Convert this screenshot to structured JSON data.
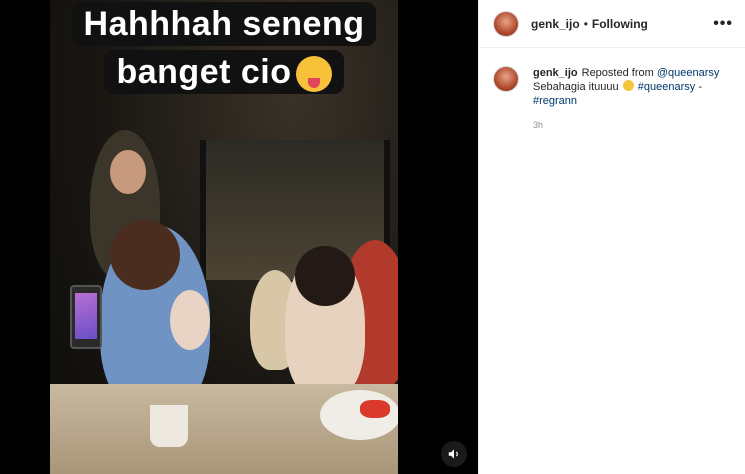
{
  "post": {
    "caption_line1": "Hahhhah seneng",
    "caption_line2": "banget cio",
    "caption_emoji": "squinting-tongue-emoji"
  },
  "controls": {
    "sound_icon": "speaker-icon"
  },
  "header": {
    "username": "genk_ijo",
    "separator": "•",
    "follow_status": "Following",
    "more": "•••"
  },
  "comment": {
    "username": "genk_ijo",
    "reposted_text": "Reposted from",
    "mention": "@queenarsy",
    "message": "Sebahagia ituuuu",
    "emoji": "grinning-emoji",
    "hashtag1": "#queenarsy",
    "dash": "-",
    "hashtag2": "#regrann",
    "time": "3h"
  }
}
